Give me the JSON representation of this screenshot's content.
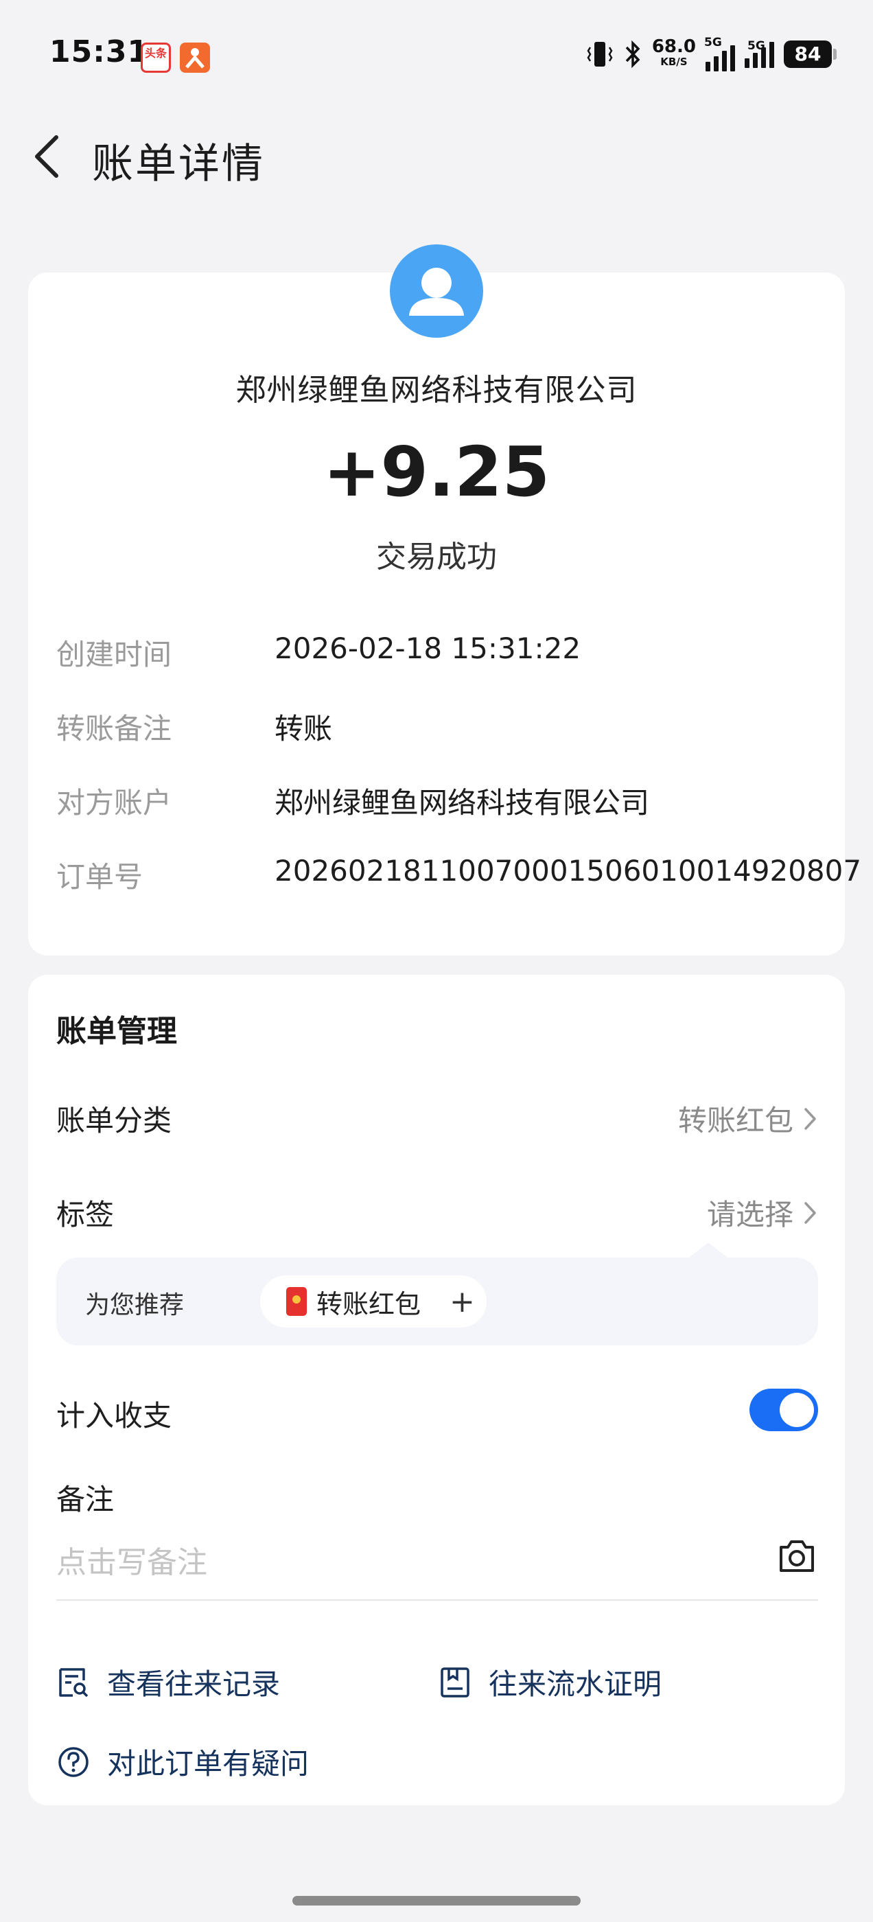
{
  "status_bar": {
    "time": "15:31",
    "app_icon_1_text": "头条",
    "net_speed": "68.0",
    "net_unit": "KB/S",
    "sim1": "5G",
    "sim2": "5G",
    "battery": "84"
  },
  "header": {
    "title": "账单详情"
  },
  "summary": {
    "merchant": "郑州绿鲤鱼网络科技有限公司",
    "amount": "+9.25",
    "status": "交易成功",
    "avatar_color": "#4aa6f5"
  },
  "details": [
    {
      "label": "创建时间",
      "value": "2026-02-18 15:31:22"
    },
    {
      "label": "转账备注",
      "value": "转账"
    },
    {
      "label": "对方账户",
      "value": "郑州绿鲤鱼网络科技有限公司"
    },
    {
      "label": "订单号",
      "value": "20260218110070001506010014920807"
    }
  ],
  "management": {
    "title": "账单管理",
    "category_label": "账单分类",
    "category_value": "转账红包",
    "tag_label": "标签",
    "tag_value": "请选择",
    "recommend_label": "为您推荐",
    "recommend_chip": "转账红包",
    "include_label": "计入收支",
    "include_enabled": true,
    "note_label": "备注",
    "note_placeholder": "点击写备注",
    "toggle_color": "#1a6ef5"
  },
  "links": {
    "history": "查看往来记录",
    "proof": "往来流水证明",
    "question": "对此订单有疑问"
  }
}
